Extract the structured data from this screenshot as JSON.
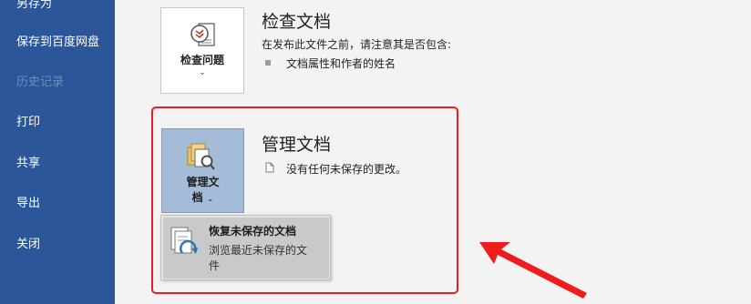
{
  "sidebar": {
    "items": [
      {
        "label": "另存为"
      },
      {
        "label": "保存到百度网盘"
      },
      {
        "label": "历史记录"
      },
      {
        "label": "打印"
      },
      {
        "label": "共享"
      },
      {
        "label": "导出"
      },
      {
        "label": "关闭"
      }
    ]
  },
  "inspect": {
    "button_label": "检查问题",
    "title": "检查文档",
    "description": "在发布此文件之前，请注意其是否包含:",
    "bullets": [
      "文档属性和作者的姓名"
    ]
  },
  "manage": {
    "button_label_line1": "管理文",
    "button_label_line2": "档",
    "title": "管理文档",
    "status": "没有任何未保存的更改。",
    "menu": {
      "recover_title": "恢复未保存的文档",
      "recover_desc": "浏览最近未保存的文件"
    }
  },
  "colors": {
    "sidebar_bg": "#2b579a",
    "highlight_border": "#ee1c1c",
    "arrow": "#ee1c1c"
  },
  "caret_glyph": "⌄"
}
